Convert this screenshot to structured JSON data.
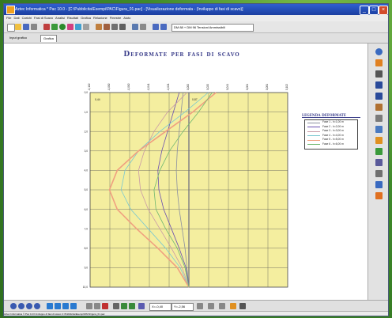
{
  "window": {
    "title": "Aztec Informatica * Pac 10.0 - [C:\\Pubblicita\\Esempi\\PAC\\Figura_01.pac] - [Visualizzazione deformata - (Inviluppo di fasi di scavo)]",
    "min": "_",
    "max": "□",
    "close": "×"
  },
  "menu": [
    "File",
    "Dati",
    "Carichi",
    "Fasi di Scavo",
    "Analisi",
    "Risultati",
    "Grafica",
    "Relazione",
    "Finestre",
    "Aiuto"
  ],
  "toolbar": {
    "combo_text": "DM 88 + DM 96 Tensioni Ammissibili"
  },
  "tabs": [
    {
      "label": "Input grafico"
    },
    {
      "label": "Grafica"
    }
  ],
  "chart_data": {
    "type": "line",
    "title": "Deformate per fasi di scavo",
    "x_ticks": [
      "-0,102",
      "-0,082",
      "-0,062",
      "-0,041",
      "-0,021",
      "0,000",
      "0,020",
      "0,041",
      "0,061",
      "0,081",
      "0,102"
    ],
    "x_range_labels": [
      "0,44",
      "0,87"
    ],
    "y_ticks": [
      "0,0",
      "1,0",
      "2,0",
      "3,0",
      "4,0",
      "5,0",
      "6,0",
      "7,0",
      "8,0",
      "9,0",
      "10,0"
    ],
    "ylim": [
      0,
      10
    ],
    "xlim": [
      -0.102,
      0.102
    ],
    "legend_title": "Legenda deformate",
    "series": [
      {
        "name": "Fase 1 - h=1,00 m",
        "color": "#8a8fa0",
        "points": [
          [
            0.0,
            -0.006
          ],
          [
            1,
            -0.008
          ],
          [
            2,
            -0.01
          ],
          [
            3,
            -0.012
          ],
          [
            4,
            -0.013
          ],
          [
            5,
            -0.012
          ],
          [
            6,
            -0.01
          ],
          [
            7,
            -0.007
          ],
          [
            8,
            -0.004
          ],
          [
            9,
            -0.002
          ],
          [
            10,
            0.0
          ]
        ]
      },
      {
        "name": "Fase 2 - h=2,00 m",
        "color": "#6a4fb0",
        "points": [
          [
            0.0,
            -0.01
          ],
          [
            1,
            -0.016
          ],
          [
            2,
            -0.022
          ],
          [
            3,
            -0.028
          ],
          [
            4,
            -0.032
          ],
          [
            5,
            -0.031
          ],
          [
            6,
            -0.026
          ],
          [
            7,
            -0.018
          ],
          [
            8,
            -0.01
          ],
          [
            9,
            -0.003
          ],
          [
            10,
            0.0
          ]
        ]
      },
      {
        "name": "Fase 3 - h=3,00 m",
        "color": "#c99aa6",
        "points": [
          [
            0.0,
            -0.002
          ],
          [
            1,
            -0.022
          ],
          [
            2,
            -0.036
          ],
          [
            3,
            -0.046
          ],
          [
            4,
            -0.052
          ],
          [
            5,
            -0.05
          ],
          [
            6,
            -0.042
          ],
          [
            7,
            -0.03
          ],
          [
            8,
            -0.018
          ],
          [
            9,
            -0.007
          ],
          [
            10,
            0.0
          ]
        ]
      },
      {
        "name": "Fase 4 - h=4,00 m",
        "color": "#7ac8d0",
        "points": [
          [
            0.0,
            0.02
          ],
          [
            1,
            -0.004
          ],
          [
            2,
            -0.03
          ],
          [
            3,
            -0.052
          ],
          [
            4,
            -0.066
          ],
          [
            5,
            -0.07
          ],
          [
            6,
            -0.06
          ],
          [
            7,
            -0.042
          ],
          [
            8,
            -0.024
          ],
          [
            9,
            -0.009
          ],
          [
            10,
            0.0
          ]
        ]
      },
      {
        "name": "Fase 5 - h=5,00 m",
        "color": "#f0a080",
        "points": [
          [
            0.0,
            0.028
          ],
          [
            1,
            0.004
          ],
          [
            2,
            -0.024
          ],
          [
            3,
            -0.052
          ],
          [
            4,
            -0.074
          ],
          [
            5,
            -0.082
          ],
          [
            6,
            -0.074
          ],
          [
            7,
            -0.054
          ],
          [
            8,
            -0.032
          ],
          [
            9,
            -0.012
          ],
          [
            10,
            0.0
          ]
        ]
      },
      {
        "name": "Fase 6 - h=6,00 m",
        "color": "#70b870",
        "points": [
          [
            0.0,
            0.024
          ],
          [
            1,
            0.01
          ],
          [
            2,
            -0.006
          ],
          [
            3,
            -0.02
          ],
          [
            4,
            -0.03
          ],
          [
            5,
            -0.036
          ],
          [
            6,
            -0.034
          ],
          [
            7,
            -0.024
          ],
          [
            8,
            -0.012
          ],
          [
            9,
            -0.004
          ],
          [
            10,
            0.0
          ]
        ]
      }
    ]
  },
  "bottombar": {
    "x_coord": "X=-0,40",
    "y_coord": "Y=-2,56"
  },
  "status": {
    "text": "Aztec Informatica © Pac 10.0   Inviluppo di fasi di scavo   C:\\Pubblicita\\Esempi\\PAC\\Figura_01.pac"
  },
  "colors": {
    "plot_bg": "#f4ee9f",
    "accent": "#3a3d8a"
  }
}
